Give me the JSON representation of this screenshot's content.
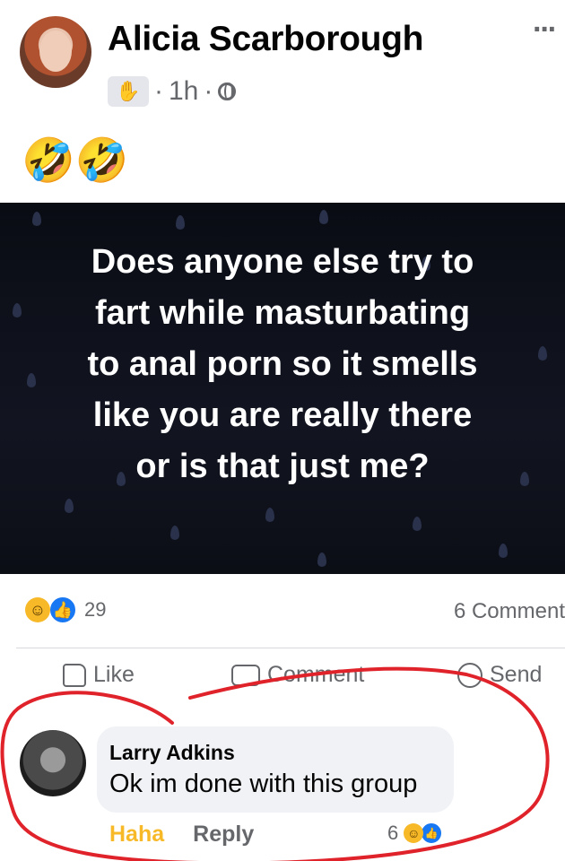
{
  "post": {
    "author": "Alicia Scarborough",
    "time": "1h",
    "separator": "·",
    "badge_icon": "waving-hand-icon",
    "privacy_icon": "globe-icon",
    "more_label": "···",
    "emojis": "🤣🤣"
  },
  "image": {
    "text": "Does anyone else try to\nfart while masturbating\nto anal porn so it smells\nlike you are really there\nor is that just me?"
  },
  "reactions": {
    "count": "29",
    "comments": "6 Comment",
    "icons": [
      "haha-reaction-icon",
      "like-reaction-icon"
    ]
  },
  "actions": {
    "like": "Like",
    "comment": "Comment",
    "send": "Send"
  },
  "comment": {
    "author": "Larry Adkins",
    "text": "Ok im done with this group",
    "haha": "Haha",
    "reply": "Reply",
    "reaction_count": "6"
  },
  "colors": {
    "annotation": "#e0222a",
    "haha": "#f7b928",
    "like": "#1877f2"
  }
}
